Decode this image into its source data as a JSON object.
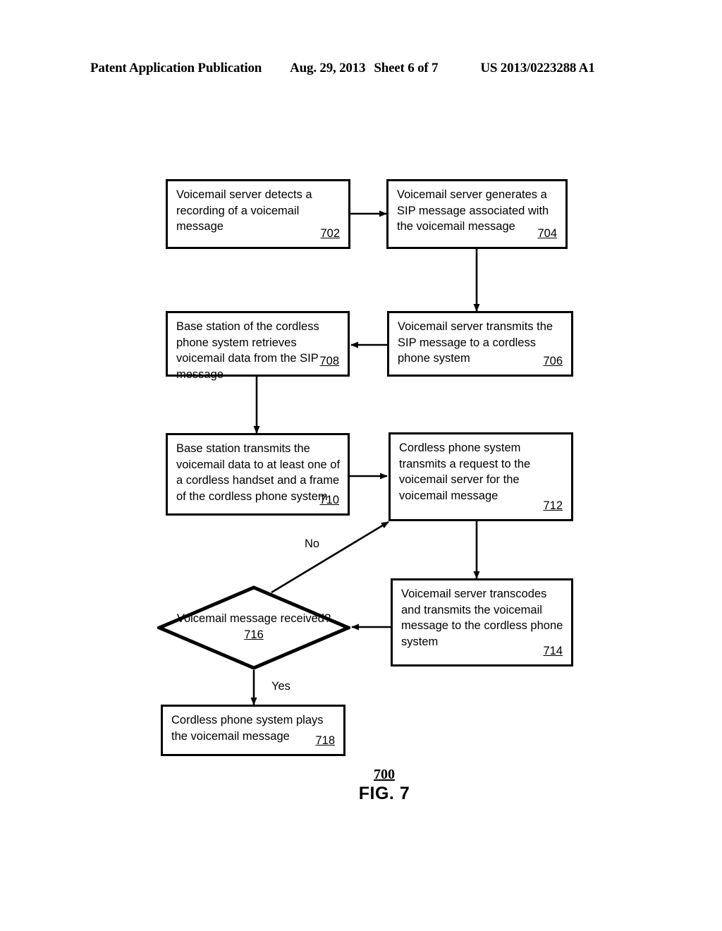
{
  "header": {
    "publication": "Patent Application Publication",
    "date": "Aug. 29, 2013",
    "sheet": "Sheet 6 of 7",
    "patent_number": "US 2013/0223288 A1"
  },
  "figure": {
    "number": "700",
    "label": "FIG. 7"
  },
  "flowchart": {
    "type": "flowchart",
    "nodes": [
      {
        "id": "702",
        "shape": "process",
        "text": "Voicemail server detects a recording of a voicemail message",
        "ref": "702"
      },
      {
        "id": "704",
        "shape": "process",
        "text": "Voicemail server generates a SIP message associated with the voicemail message",
        "ref": "704"
      },
      {
        "id": "706",
        "shape": "process",
        "text": "Voicemail server transmits the SIP message to a cordless phone system",
        "ref": "706"
      },
      {
        "id": "708",
        "shape": "process",
        "text": "Base station of the cordless phone system retrieves voicemail data from the SIP message",
        "ref": "708"
      },
      {
        "id": "710",
        "shape": "process",
        "text": "Base station transmits the voicemail data to at least one of a cordless handset and a frame of the cordless phone system",
        "ref": "710"
      },
      {
        "id": "712",
        "shape": "process",
        "text": "Cordless phone system transmits a request to the voicemail server for the voicemail message",
        "ref": "712"
      },
      {
        "id": "714",
        "shape": "process",
        "text": "Voicemail server transcodes and transmits the voicemail message to the cordless phone system",
        "ref": "714"
      },
      {
        "id": "716",
        "shape": "decision",
        "text": "Voicemail message received?",
        "ref": "716"
      },
      {
        "id": "718",
        "shape": "process",
        "text": "Cordless phone system plays the voicemail message",
        "ref": "718"
      }
    ],
    "edges": [
      {
        "from": "702",
        "to": "704",
        "label": ""
      },
      {
        "from": "704",
        "to": "706",
        "label": ""
      },
      {
        "from": "706",
        "to": "708",
        "label": ""
      },
      {
        "from": "708",
        "to": "710",
        "label": ""
      },
      {
        "from": "710",
        "to": "712",
        "label": ""
      },
      {
        "from": "712",
        "to": "714",
        "label": ""
      },
      {
        "from": "714",
        "to": "716",
        "label": ""
      },
      {
        "from": "716",
        "to": "712",
        "label": "No"
      },
      {
        "from": "716",
        "to": "718",
        "label": "Yes"
      }
    ],
    "edge_labels": {
      "no": "No",
      "yes": "Yes"
    }
  },
  "colors": {
    "ink": "#000000",
    "paper": "#ffffff"
  }
}
